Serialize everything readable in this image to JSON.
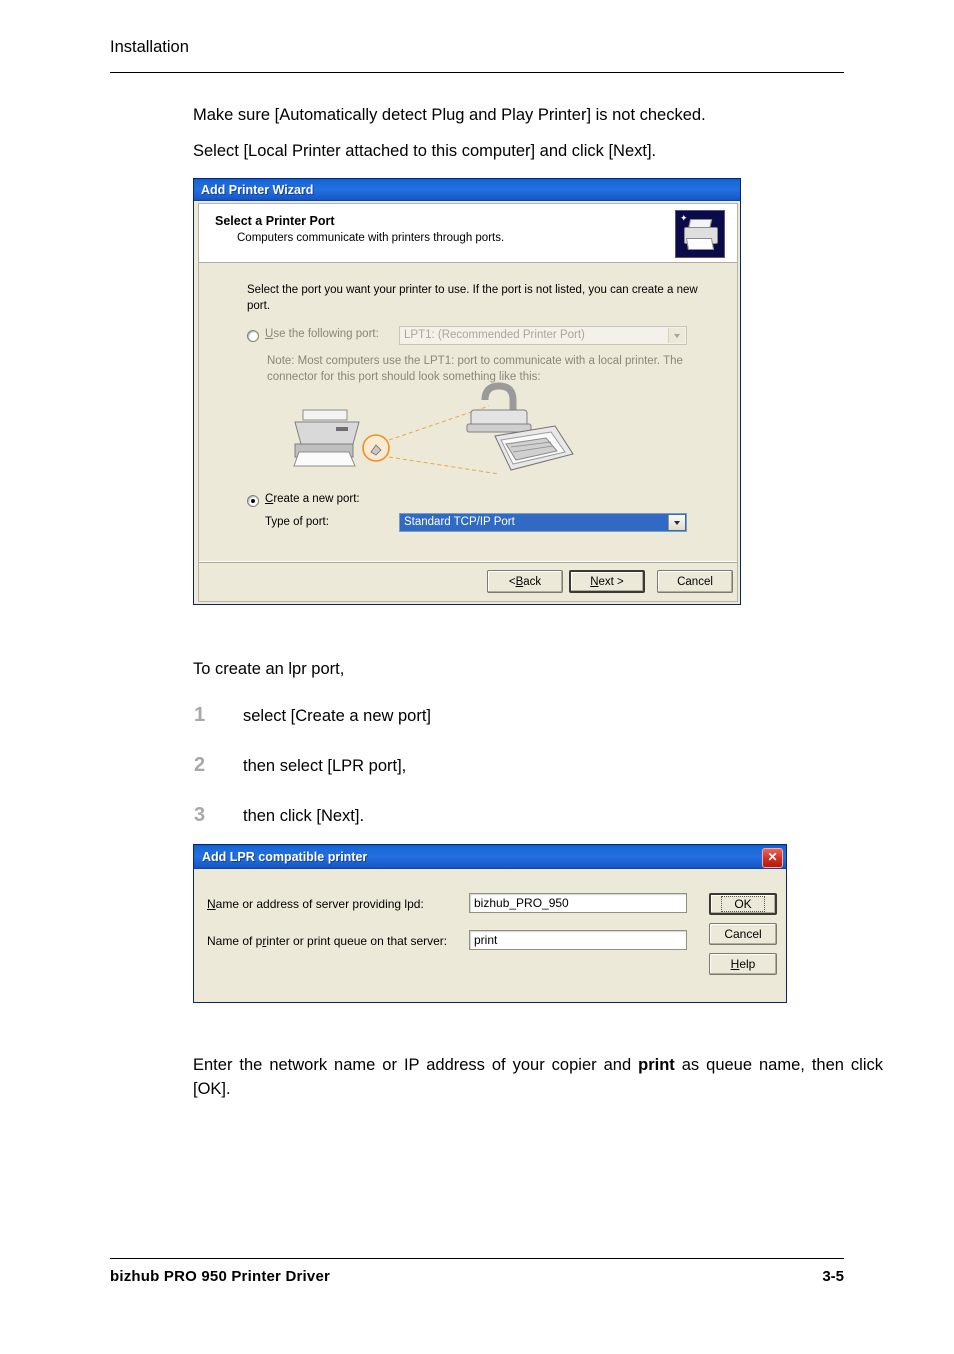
{
  "page": {
    "header": "Installation",
    "footer_left": "bizhub PRO 950 Printer Driver",
    "footer_right": "3-5"
  },
  "body": {
    "para1": "Make sure [Automatically detect Plug and Play Printer] is not checked.",
    "para2": "Select [Local Printer attached to this computer] and click [Next].",
    "para3": "To create an lpr port,",
    "steps": [
      {
        "num": "1",
        "text": "select [Create a new port]"
      },
      {
        "num": "2",
        "text": "then select [LPR port],"
      },
      {
        "num": "3",
        "text": "then click [Next]."
      }
    ],
    "closing_pre": "Enter the network name or IP address of your copier and ",
    "closing_bold": "print",
    "closing_post": " as queue name, then click [OK]."
  },
  "wizard": {
    "title": "Add Printer Wizard",
    "banner_title": "Select a Printer Port",
    "banner_subtitle": "Computers communicate with printers through ports.",
    "intro": "Select the port you want your printer to use.  If the port is not listed, you can create a new port.",
    "use_following_port_label": "Use the following port:",
    "port_value": "LPT1: (Recommended Printer Port)",
    "note": "Note: Most computers use the LPT1: port to communicate with a local printer. The connector for this port should look something like this:",
    "create_new_port_label": "Create a new port:",
    "type_of_port_label": "Type of port:",
    "type_value": "Standard TCP/IP Port",
    "buttons": {
      "back": "< Back",
      "next": "Next >",
      "cancel": "Cancel"
    }
  },
  "lpr_dialog": {
    "title": "Add LPR compatible printer",
    "close_glyph": "✕",
    "label_server": "Name or address of server providing lpd:",
    "value_server": "bizhub_PRO_950",
    "label_queue": "Name of printer or print queue on that server:",
    "value_queue": "print",
    "buttons": {
      "ok": "OK",
      "cancel": "Cancel",
      "help": "Help"
    }
  }
}
